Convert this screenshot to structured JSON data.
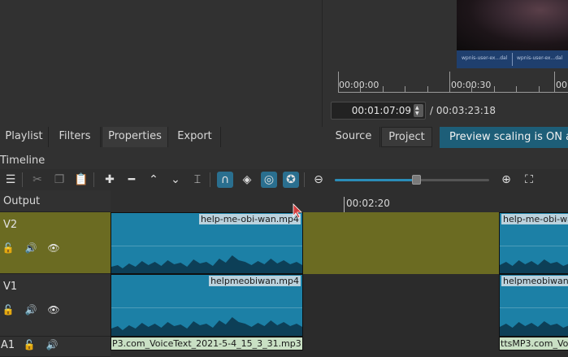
{
  "player": {
    "ruler_labels": [
      "00:00:00",
      "00:00:30",
      "00"
    ],
    "preview_labels": [
      "wpnis-user-ex...dal",
      "wpnis-user-ex...dal"
    ],
    "current_time": "00:01:07:09",
    "duration": "/ 00:03:23:18"
  },
  "tabs_left": [
    "Playlist",
    "Filters",
    "Properties",
    "Export"
  ],
  "tabs_right": [
    "Source",
    "Project"
  ],
  "notice": "Preview scaling is ON at",
  "timeline": {
    "title": "Timeline",
    "output_label": "Output",
    "ruler_label": "00:02:20",
    "tracks": [
      {
        "name": "V2",
        "icons": [
          "lock-icon",
          "speaker-icon",
          "eye-icon"
        ],
        "color": "#6b6b22"
      },
      {
        "name": "V1",
        "icons": [
          "lock-icon",
          "speaker-icon",
          "eye-icon"
        ],
        "color": "#2b2b2b"
      },
      {
        "name": "A1",
        "icons": [
          "lock-icon",
          "speaker-icon"
        ],
        "color": "#2b2b2b"
      }
    ],
    "clips": {
      "v2_a": "help-me-obi-wan.mp4",
      "v2_b": "help-me-obi-wa",
      "v1_a": "helpmeobiwan.mp4",
      "v1_b": "helpmeobiwan.",
      "a1_a": "P3.com_VoiceText_2021-5-4_15_3_31.mp3",
      "a1_b": "ttsMP3.com_Vo"
    }
  },
  "colors": {
    "clip": "#1c80a6",
    "track_selected": "#6b6b22",
    "accent": "#2a6f8f",
    "notice": "#1d5e78",
    "audio_clip": "#c9e0c4"
  }
}
